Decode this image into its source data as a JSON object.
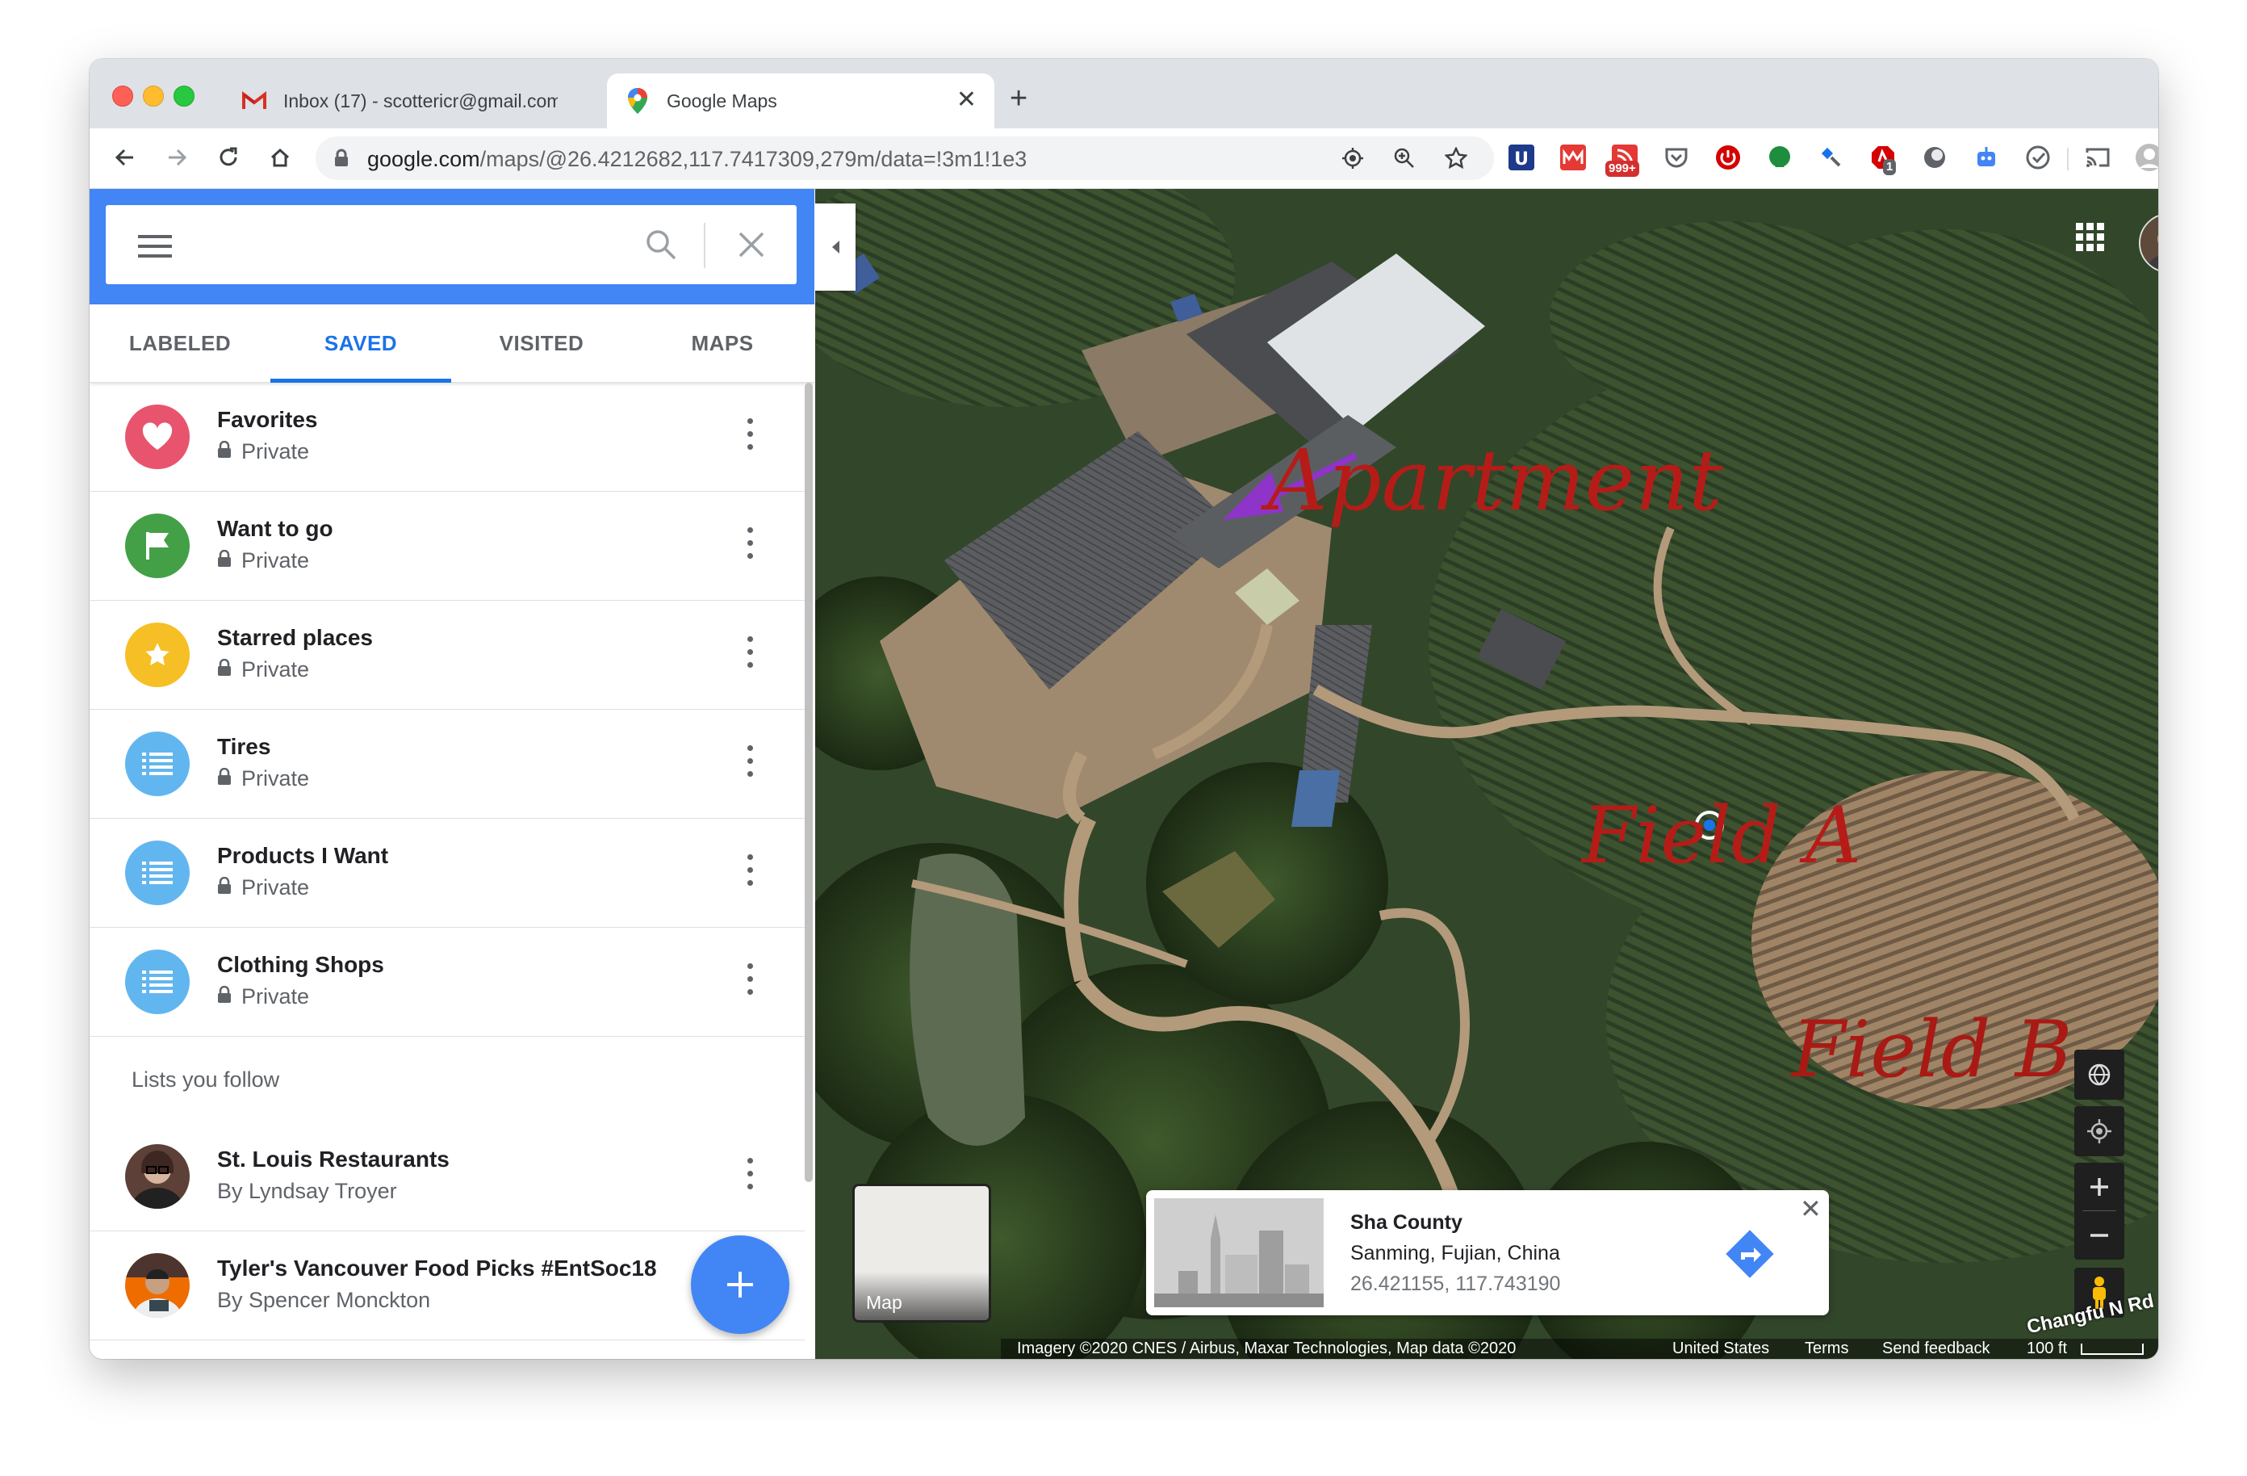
{
  "browser": {
    "tabs": [
      {
        "title": "Inbox (17) - scottericr@gmail.com",
        "favicon": "gmail-icon",
        "active": false
      },
      {
        "title": "Google Maps",
        "favicon": "google-maps-icon",
        "active": true
      }
    ],
    "url_host": "google.com",
    "url_path": "/maps/@26.4212682,117.7417309,279m/data=!3m1!1e3",
    "ext_badges": {
      "rss": "999+",
      "adblock": "1"
    }
  },
  "sidebar": {
    "tabs": [
      "LABELED",
      "SAVED",
      "VISITED",
      "MAPS"
    ],
    "active_tab": "SAVED",
    "lists": [
      {
        "name": "Favorites",
        "sub": "Private",
        "icon": "heart-icon",
        "color": "#e8546e"
      },
      {
        "name": "Want to go",
        "sub": "Private",
        "icon": "flag-icon",
        "color": "#43a047"
      },
      {
        "name": "Starred places",
        "sub": "Private",
        "icon": "star-icon",
        "color": "#f6bf26"
      },
      {
        "name": "Tires",
        "sub": "Private",
        "icon": "list-icon",
        "color": "#62b6ef"
      },
      {
        "name": "Products I Want",
        "sub": "Private",
        "icon": "list-icon",
        "color": "#62b6ef"
      },
      {
        "name": "Clothing Shops",
        "sub": "Private",
        "icon": "list-icon",
        "color": "#62b6ef"
      }
    ],
    "follow_heading": "Lists you follow",
    "followed": [
      {
        "name": "St. Louis Restaurants",
        "sub": "By Lyndsay Troyer"
      },
      {
        "name": "Tyler's Vancouver Food Picks #EntSoc18",
        "sub": "By Spencer Monckton"
      }
    ]
  },
  "map": {
    "layer_label": "Map",
    "annotations": {
      "apartment": "Apartment",
      "field_a": "Field A",
      "field_b": "Field B"
    },
    "road_label": "Changfu N Rd",
    "info": {
      "title": "Sha County",
      "region": "Sanming, Fujian, China",
      "coords": "26.421155, 117.743190"
    },
    "footer": {
      "imagery": "Imagery ©2020 CNES / Airbus, Maxar Technologies, Map data ©2020",
      "country": "United States",
      "terms": "Terms",
      "feedback": "Send feedback",
      "scale": "100 ft"
    }
  }
}
